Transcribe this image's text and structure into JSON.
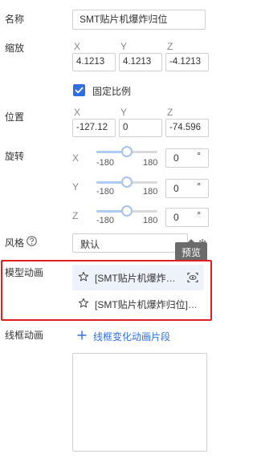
{
  "name_row": {
    "label": "名称",
    "value": "SMT贴片机爆炸归位"
  },
  "scale": {
    "label": "缩放",
    "axes": [
      "X",
      "Y",
      "Z"
    ],
    "values": [
      "4.1213",
      "4.1213",
      "-4.1213"
    ],
    "lock_checkbox_label": "固定比例",
    "lock_checked": true
  },
  "position": {
    "label": "位置",
    "axes": [
      "X",
      "Y",
      "Z"
    ],
    "values": [
      "-127.12",
      "0",
      "-74.596"
    ]
  },
  "rotation": {
    "label": "旋转",
    "rows": [
      {
        "axis": "X",
        "min": "-180",
        "max": "180",
        "value": "0",
        "unit": "°",
        "level": 0.5
      },
      {
        "axis": "Y",
        "min": "-180",
        "max": "180",
        "value": "0",
        "unit": "°",
        "level": 0.5
      },
      {
        "axis": "Z",
        "min": "-180",
        "max": "180",
        "value": "0",
        "unit": "°",
        "level": 0.5
      }
    ]
  },
  "style": {
    "label": "风格",
    "help_icon": "question-circle-icon",
    "value": "默认",
    "tooltip": "预览"
  },
  "model_animation": {
    "label": "模型动画",
    "items": [
      {
        "text": "[SMT贴片机爆炸…",
        "star_icon": "star-outline-icon",
        "action_icon": "preview-icon"
      },
      {
        "text": "[SMT贴片机爆炸归位]…",
        "star_icon": "star-outline-icon"
      }
    ],
    "highlight_color": "#e02020"
  },
  "wireframe_animation": {
    "label": "线框动画",
    "add_label": "线框变化动画片段",
    "add_icon": "plus-icon"
  },
  "colors": {
    "accent": "#2f6fdf",
    "checkbox": "#2d6fe0",
    "tooltip_bg": "#6b6b6b"
  }
}
